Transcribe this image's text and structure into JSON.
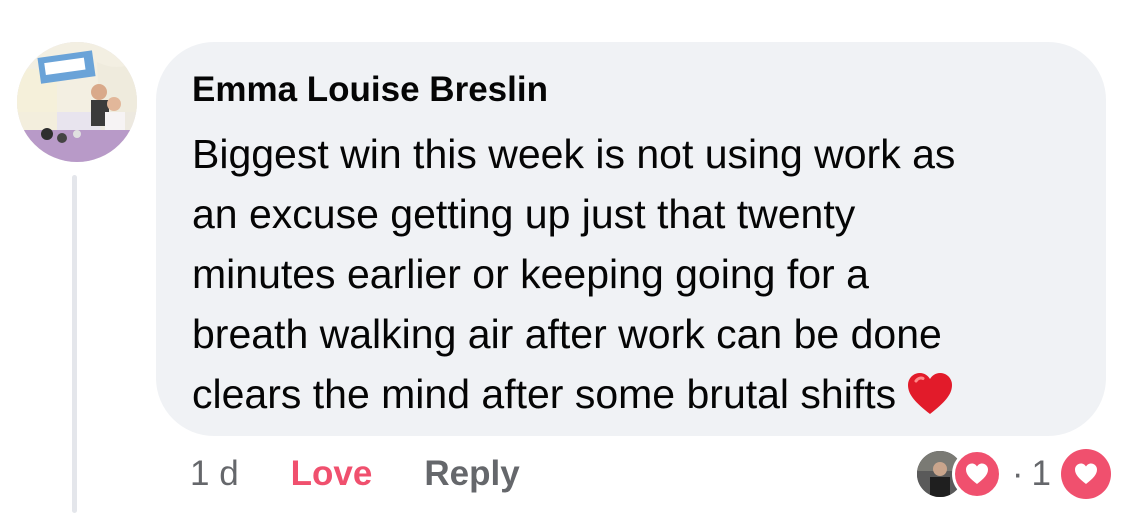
{
  "comment": {
    "author": "Emma Louise Breslin",
    "lines": [
      "Biggest win this week is not using work as",
      "an excuse getting up just that twenty",
      "minutes earlier or keeping going for a",
      "breath walking air after work can be done",
      "clears the mind after some brutal shifts"
    ],
    "emoji": "red-heart"
  },
  "actions": {
    "timestamp": "1 d",
    "love_label": "Love",
    "reply_label": "Reply"
  },
  "reactions": {
    "separator": "·",
    "count": "1",
    "icons": [
      "reactor-avatar",
      "love-reaction-icon",
      "love-reaction-icon"
    ]
  },
  "colors": {
    "bubble": "#f0f2f5",
    "love": "#f0506e",
    "secondary_text": "#65676b",
    "primary_text": "#050505"
  }
}
